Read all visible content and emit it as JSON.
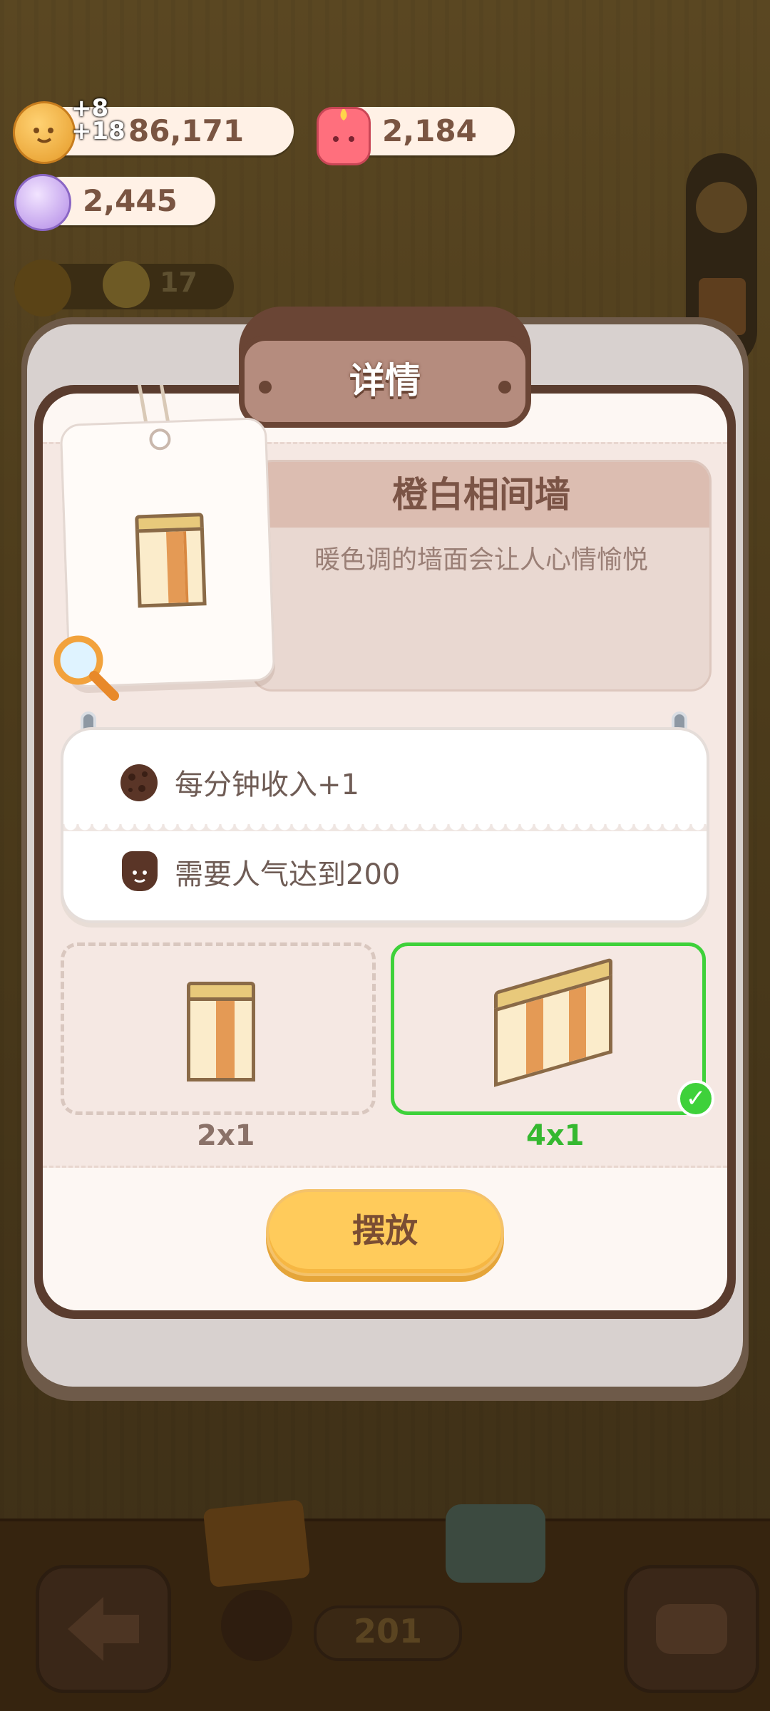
{
  "currencies": {
    "coins": {
      "value": "86,171",
      "floating_top": "+8",
      "floating_bottom": "+18",
      "icon": "cookie-coin-icon"
    },
    "candles": {
      "value": "2,184",
      "icon": "pink-candle-icon"
    },
    "candy": {
      "value": "2,445",
      "icon": "candy-icon"
    },
    "popularity": {
      "value": "17",
      "icon": "chick-icon"
    }
  },
  "dialog": {
    "title": "详情",
    "item_name": "橙白相间墙",
    "item_description": "暖色调的墙面会让人心情愉悦",
    "effects": [
      {
        "icon": "cookie-icon",
        "text": "每分钟收入+1"
      },
      {
        "icon": "popularity-icon",
        "text": "需要人气达到200"
      }
    ],
    "sizes": [
      {
        "label": "2x1",
        "selected": false
      },
      {
        "label": "4x1",
        "selected": true
      }
    ],
    "place_button": "摆放"
  },
  "bottom_bar": {
    "counter": "201"
  },
  "colors": {
    "accent_green": "#3ed13a",
    "button_yellow": "#ffcb5b",
    "plaque_brown": "#b58c7e"
  }
}
